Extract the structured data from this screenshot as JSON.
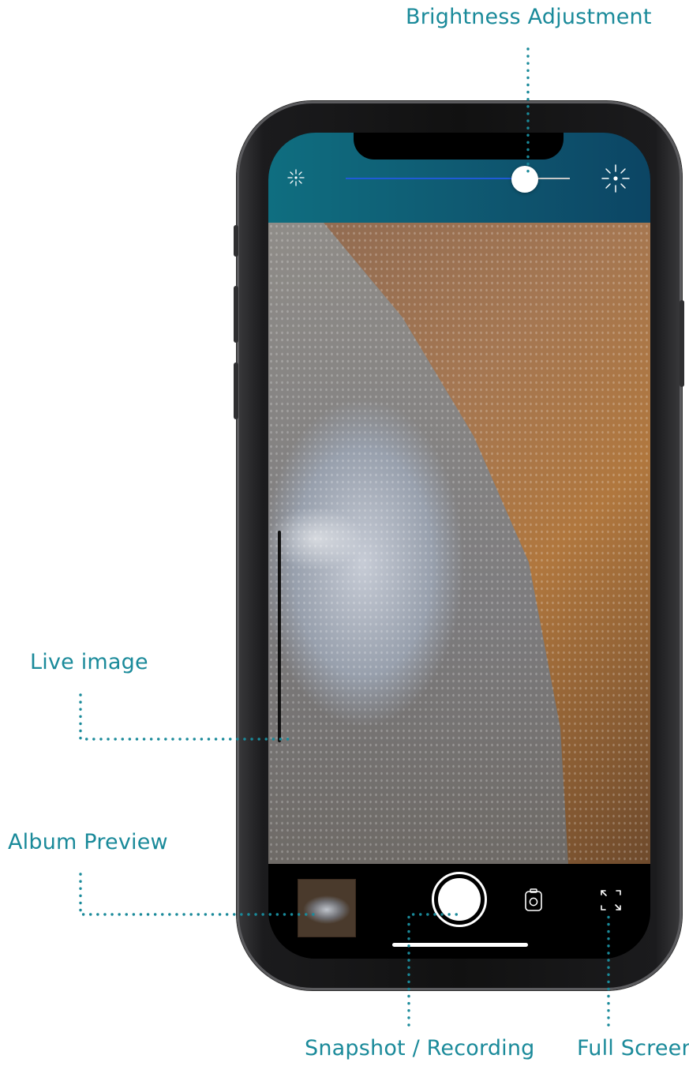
{
  "annotations": {
    "brightness": "Brightness Adjustment",
    "live_image": "Live image",
    "album_preview": "Album Preview",
    "snapshot": "Snapshot / Recording",
    "full_screen": "Full Screen"
  },
  "brightness_slider": {
    "level": 0.8,
    "min_icon": "brightness-low-icon",
    "max_icon": "brightness-high-icon"
  },
  "bottom_bar": {
    "album_icon": "album-thumbnail",
    "shutter_icon": "shutter-icon",
    "switch_icon": "camera-switch-icon",
    "fullscreen_icon": "fullscreen-icon"
  },
  "colors": {
    "annotation": "#1a8a9a",
    "topbar": "#0f5a72",
    "slider_fill": "#1f5bd6"
  }
}
